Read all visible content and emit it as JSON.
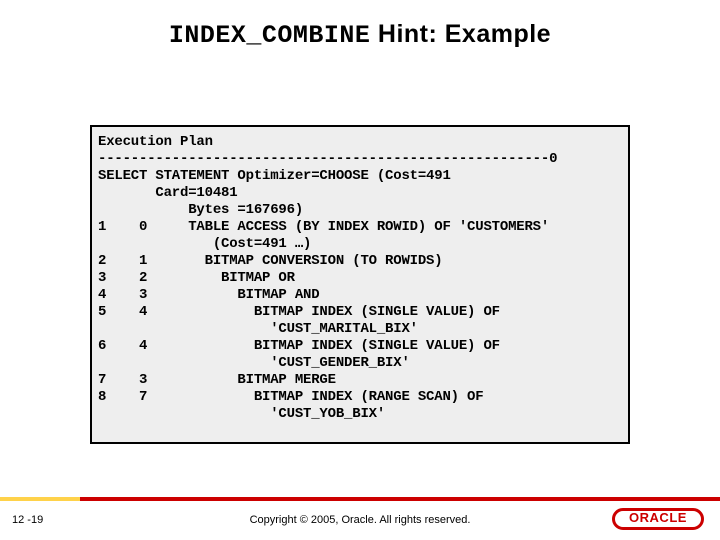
{
  "title": {
    "mono": "INDEX_COMBINE",
    "rest": " Hint: Example"
  },
  "plan": {
    "l01": "Execution Plan",
    "l02": "-------------------------------------------------------0",
    "l03": "SELECT STATEMENT Optimizer=CHOOSE (Cost=491",
    "l04": "       Card=10481",
    "l05": "           Bytes =167696)",
    "l06": "1    0     TABLE ACCESS (BY INDEX ROWID) OF 'CUSTOMERS'",
    "l07": "              (Cost=491 …)",
    "l08": "2    1       BITMAP CONVERSION (TO ROWIDS)",
    "l09": "3    2         BITMAP OR",
    "l10": "4    3           BITMAP AND",
    "l11": "5    4             BITMAP INDEX (SINGLE VALUE) OF",
    "l12": "                     'CUST_MARITAL_BIX'",
    "l13": "6    4             BITMAP INDEX (SINGLE VALUE) OF",
    "l14": "                     'CUST_GENDER_BIX'",
    "l15": "7    3           BITMAP MERGE",
    "l16": "8    7             BITMAP INDEX (RANGE SCAN) OF",
    "l17": "                     'CUST_YOB_BIX'"
  },
  "footer": {
    "page": "12 -19",
    "copyright": "Copyright © 2005, Oracle.  All rights reserved.",
    "logo_text": "ORACLE"
  }
}
